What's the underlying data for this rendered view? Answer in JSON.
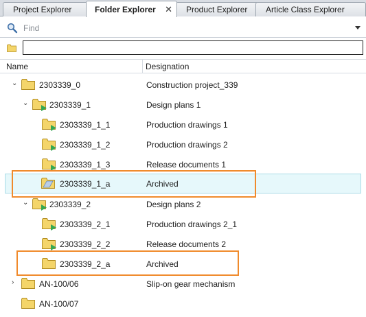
{
  "tabs": [
    {
      "label": "Project Explorer"
    },
    {
      "label": "Folder Explorer",
      "active": true,
      "close": "✕"
    },
    {
      "label": "Product Explorer"
    },
    {
      "label": "Article Class Explorer"
    }
  ],
  "find": {
    "placeholder": "Find"
  },
  "path": {
    "value": ""
  },
  "columns": {
    "name": "Name",
    "designation": "Designation"
  },
  "tree": [
    {
      "name": "2303339_0",
      "designation": "Construction project_339",
      "expander": "down",
      "folder": "plain"
    },
    {
      "name": "2303339_1",
      "designation": "Design plans 1",
      "expander": "down",
      "folder": "green"
    },
    {
      "name": "2303339_1_1",
      "designation": "Production drawings 1",
      "expander": "none",
      "folder": "green"
    },
    {
      "name": "2303339_1_2",
      "designation": "Production drawings 2",
      "expander": "none",
      "folder": "green"
    },
    {
      "name": "2303339_1_3",
      "designation": "Release documents 1",
      "expander": "none",
      "folder": "green"
    },
    {
      "name": "2303339_1_a",
      "designation": "Archived",
      "expander": "none",
      "folder": "archive",
      "selected": true
    },
    {
      "name": "2303339_2",
      "designation": "Design plans 2",
      "expander": "down",
      "folder": "green"
    },
    {
      "name": "2303339_2_1",
      "designation": "Production drawings 2_1",
      "expander": "none",
      "folder": "green"
    },
    {
      "name": "2303339_2_2",
      "designation": "Release documents 2",
      "expander": "none",
      "folder": "green"
    },
    {
      "name": "2303339_2_a",
      "designation": "Archived",
      "expander": "none",
      "folder": "plain"
    },
    {
      "name": "AN-100/06",
      "designation": "Slip-on gear mechanism",
      "expander": "right",
      "folder": "plain"
    },
    {
      "name": "AN-100/07",
      "designation": "",
      "expander": "none",
      "folder": "plain"
    }
  ],
  "colors": {
    "highlight": "#f08a2b",
    "selection": "#e6f8fb",
    "folder": "#f4d56a"
  }
}
